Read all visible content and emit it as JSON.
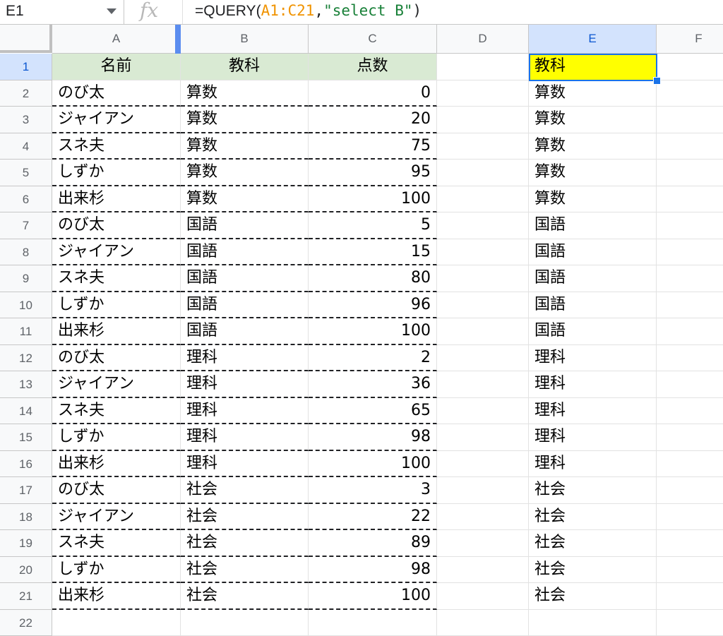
{
  "formula_bar": {
    "name_box": "E1",
    "fx_label": "fx",
    "formula_prefix": "=QUERY(",
    "formula_ref": "A1:C21",
    "formula_sep": ",",
    "formula_string": "\"select B\"",
    "formula_suffix": ")"
  },
  "columns": [
    "A",
    "B",
    "C",
    "D",
    "E",
    "F"
  ],
  "rows": [
    "1",
    "2",
    "3",
    "4",
    "5",
    "6",
    "7",
    "8",
    "9",
    "10",
    "11",
    "12",
    "13",
    "14",
    "15",
    "16",
    "17",
    "18",
    "19",
    "20",
    "21",
    "22"
  ],
  "table": {
    "headers": [
      "名前",
      "教科",
      "点数"
    ],
    "data": [
      [
        "のび太",
        "算数",
        "0"
      ],
      [
        "ジャイアン",
        "算数",
        "20"
      ],
      [
        "スネ夫",
        "算数",
        "75"
      ],
      [
        "しずか",
        "算数",
        "95"
      ],
      [
        "出来杉",
        "算数",
        "100"
      ],
      [
        "のび太",
        "国語",
        "5"
      ],
      [
        "ジャイアン",
        "国語",
        "15"
      ],
      [
        "スネ夫",
        "国語",
        "80"
      ],
      [
        "しずか",
        "国語",
        "96"
      ],
      [
        "出来杉",
        "国語",
        "100"
      ],
      [
        "のび太",
        "理科",
        "2"
      ],
      [
        "ジャイアン",
        "理科",
        "36"
      ],
      [
        "スネ夫",
        "理科",
        "65"
      ],
      [
        "しずか",
        "理科",
        "98"
      ],
      [
        "出来杉",
        "理科",
        "100"
      ],
      [
        "のび太",
        "社会",
        "3"
      ],
      [
        "ジャイアン",
        "社会",
        "22"
      ],
      [
        "スネ夫",
        "社会",
        "89"
      ],
      [
        "しずか",
        "社会",
        "98"
      ],
      [
        "出来杉",
        "社会",
        "100"
      ]
    ]
  },
  "query_result": [
    "教科",
    "算数",
    "算数",
    "算数",
    "算数",
    "算数",
    "国語",
    "国語",
    "国語",
    "国語",
    "国語",
    "理科",
    "理科",
    "理科",
    "理科",
    "理科",
    "社会",
    "社会",
    "社会",
    "社会",
    "社会"
  ],
  "colors": {
    "header_fill": "#d9ead3",
    "selected_cell_fill": "#ffff00",
    "selection_border": "#1a73e8"
  }
}
